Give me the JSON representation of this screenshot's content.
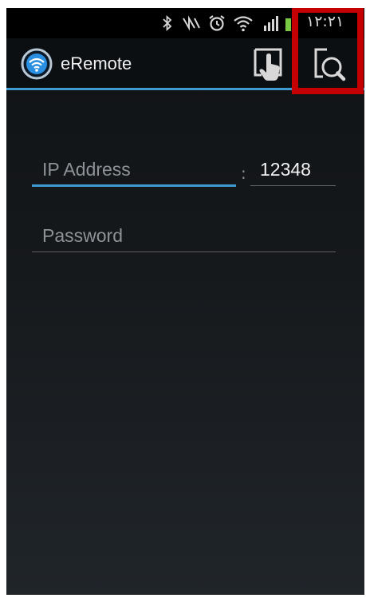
{
  "status_bar": {
    "time": "١٢:٢١",
    "icons": [
      "bluetooth-icon",
      "nfc-icon",
      "alarm-icon",
      "wifi-icon",
      "signal-icon",
      "battery-icon"
    ]
  },
  "action_bar": {
    "app_title": "eRemote",
    "actions": [
      "touch-icon",
      "search-icon"
    ],
    "accent_color": "#3f9ad0"
  },
  "form": {
    "ip_address": {
      "placeholder": "IP Address",
      "value": ""
    },
    "separator": ":",
    "port": {
      "value": "12348"
    },
    "password": {
      "placeholder": "Password",
      "value": ""
    }
  },
  "annotation": {
    "highlight_color": "#c40000",
    "highlighted_element": "search-button"
  }
}
